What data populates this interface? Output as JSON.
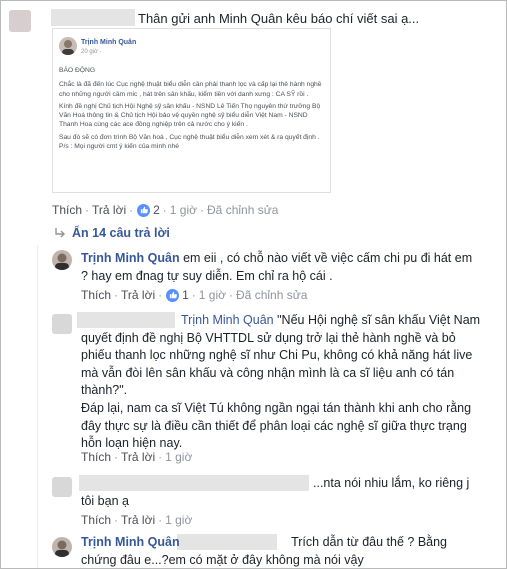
{
  "top_comment": {
    "text": "Thân gửi anh Minh Quân kêu báo chí viết sai ạ...",
    "actions": {
      "like": "Thích",
      "reply": "Trả lời",
      "reactions": "2",
      "time": "1 giờ",
      "edited": "Đã chỉnh sửa"
    }
  },
  "shared_post": {
    "author": "Trịnh Minh Quân",
    "time": "20 giờ ·",
    "title": "BÁO ĐỘNG",
    "paragraphs": [
      "Chắc là đã đến lúc Cục nghệ thuật biểu diễn cần phải thanh lọc và cấp lại thẻ hành nghề cho những người cầm mic , hát trên sân khấu, kiểm tiền với danh xưng : CA SỸ rồi .",
      "Kính đề nghị Chủ tịch Hội Nghệ sỹ sân khấu - NSND Lê Tiến Thọ nguyên thứ trưởng Bộ Văn Hoá thông tin & Chủ tịch Hội bảo vệ quyền nghệ sỹ biểu diễn Việt Nam - NSND Thanh Hoa cùng các ace đồng nghiệp trên cả nước cho ý kiến .",
      "Sau đó sẽ có đơn trình Bộ Văn hoá , Cục nghệ thuật biểu diễn xem xét & ra quyết định .",
      "P/s : Mọi người cmt ý kiến của mình nhé"
    ]
  },
  "replies_toggle": "Ẩn 14 câu trả lời",
  "replies": [
    {
      "author": "Trịnh Minh Quân",
      "text": "em eii , có chỗ nào viết về việc cấm chi pu đi hát em ? hay em đnag tự suy diễn. Em chỉ ra hộ cái .",
      "actions": {
        "like": "Thích",
        "reply": "Trả lời",
        "reactions": "1",
        "time": "1 giờ",
        "edited": "Đã chỉnh sửa"
      }
    },
    {
      "mention": "Trịnh Minh Quân",
      "text_1": "\"Nếu Hội nghệ sĩ sân khấu Việt Nam quyết định đề nghị Bộ VHTTDL sử dụng trở lại thẻ hành nghề và bỏ phiếu thanh lọc những nghệ sĩ như Chi Pu, không có khả năng hát live mà vẫn đòi lên sân khấu và công nhận mình là ca sĩ liệu anh có tán thành?\".",
      "text_2": "Đáp lại, nam ca sĩ Việt Tú không ngần ngại tán thành khi anh cho rằng đây thực sự là điều cần thiết để phân loại các nghệ sĩ giữa thực trạng hỗn loạn hiện nay.",
      "actions": {
        "like": "Thích",
        "reply": "Trả lời",
        "time": "1 giờ"
      }
    },
    {
      "text": "...nta nói nhiu lắm, ko riêng j tôi bạn ạ",
      "actions": {
        "like": "Thích",
        "reply": "Trả lời",
        "time": "1 giờ"
      }
    },
    {
      "author": "Trịnh Minh Quân",
      "text": "Trích dẫn từ đâu thế ? Bằng chứng đâu e...?em có mặt ở đây không mà nói vậy"
    }
  ],
  "colors": {
    "link": "#365899",
    "meta": "#90949c",
    "like_badge": "#5890ff",
    "redaction": "#e4e4e4"
  }
}
